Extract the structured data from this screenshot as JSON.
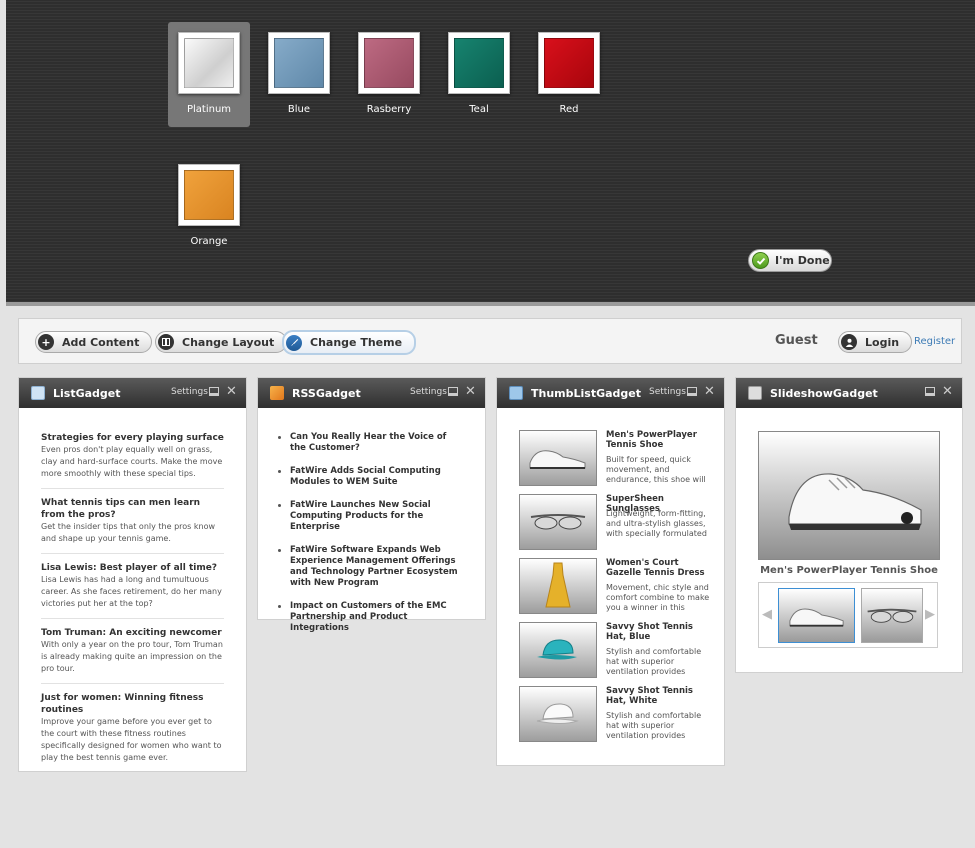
{
  "theme_picker": {
    "swatches": [
      {
        "label": "Platinum",
        "color": "#e4e4e4",
        "selected": true
      },
      {
        "label": "Blue",
        "color": "#6f98b9"
      },
      {
        "label": "Rasberry",
        "color": "#a8596f"
      },
      {
        "label": "Teal",
        "color": "#0e705e"
      },
      {
        "label": "Red",
        "color": "#c30811"
      },
      {
        "label": "Orange",
        "color": "#e8962e"
      }
    ],
    "done_label": "I'm Done"
  },
  "toolbar": {
    "add_content": "Add Content",
    "change_layout": "Change Layout",
    "change_theme": "Change Theme",
    "guest": "Guest",
    "login": "Login",
    "register": "Register"
  },
  "gadgets": {
    "settings_label": "Settings",
    "list": {
      "title": "ListGadget",
      "items": [
        {
          "title": "Strategies for every playing surface",
          "text": "Even pros don't play equally well on grass, clay and hard-surface courts. Make the move more smoothly with these special tips."
        },
        {
          "title": "What tennis tips can men learn from the pros?",
          "text": "Get the insider tips that only the pros know and shape up your tennis game."
        },
        {
          "title": "Lisa Lewis: Best player of all time?",
          "text": "Lisa Lewis has had a long and tumultuous career. As she faces retirement, do her many victories put her at the top?"
        },
        {
          "title": "Tom Truman: An exciting newcomer",
          "text": "With only a year on the pro tour, Tom Truman is already making quite an impression on the pro tour."
        },
        {
          "title": "Just for women: Winning fitness routines",
          "text": "Improve your game before you ever get to the court with these fitness routines specifically designed for women who want to play the best tennis game ever."
        }
      ]
    },
    "rss": {
      "title": "RSSGadget",
      "items": [
        "Can You Really Hear the Voice of the Customer?",
        "FatWire Adds Social Computing Modules to WEM Suite",
        "FatWire Launches New Social Computing Products for the Enterprise",
        "FatWire Software Expands Web Experience Management Offerings and Technology Partner Ecosystem with New Program",
        "Impact on Customers of the EMC Partnership and Product Integrations"
      ]
    },
    "thumblist": {
      "title": "ThumbListGadget",
      "items": [
        {
          "title": "Men's PowerPlayer Tennis Shoe",
          "desc": "Built for speed, quick movement, and endurance, this shoe will help you",
          "icon": "shoe-icon"
        },
        {
          "title": "SuperSheen Sunglasses",
          "desc": "Lightweight, form-fitting, and ultra-stylish glasses, with specially formulated lenses optimized for the",
          "icon": "sunglasses-icon"
        },
        {
          "title": "Women's Court Gazelle Tennis Dress",
          "desc": "Movement, chic style and comfort combine to make you a winner in this",
          "icon": "dress-icon"
        },
        {
          "title": "Savvy Shot Tennis Hat, Blue",
          "desc": "Stylish and comfortable hat with superior ventilation provides",
          "icon": "blue-hat-icon"
        },
        {
          "title": "Savvy Shot Tennis Hat, White",
          "desc": "Stylish and comfortable hat with superior ventilation provides",
          "icon": "white-hat-icon"
        }
      ]
    },
    "slideshow": {
      "title": "SlideshowGadget",
      "caption": "Men's PowerPlayer Tennis Shoe"
    }
  }
}
